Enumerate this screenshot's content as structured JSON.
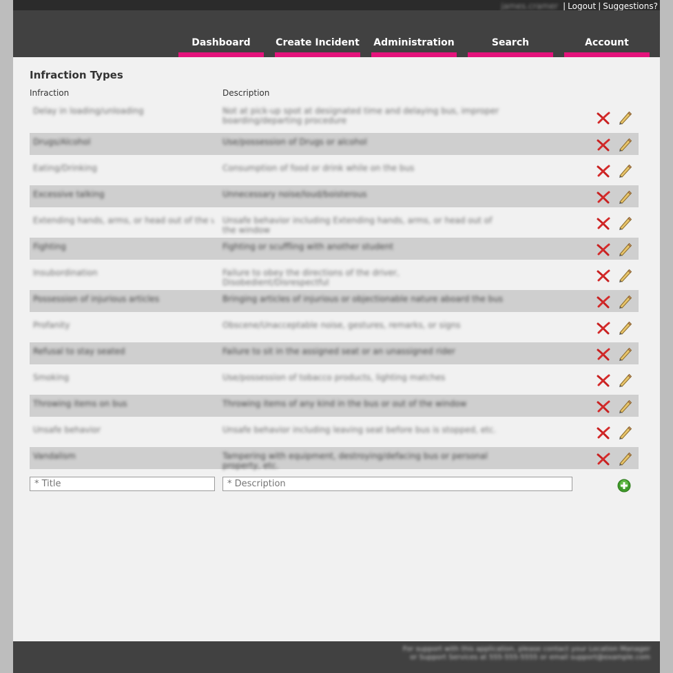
{
  "topbar": {
    "username": "james.cramer",
    "logout_label": "Logout",
    "suggestions_label": "Suggestions?",
    "separator": "|"
  },
  "nav": {
    "items": [
      {
        "label": "Dashboard"
      },
      {
        "label": "Create Incident"
      },
      {
        "label": "Administration"
      },
      {
        "label": "Search"
      },
      {
        "label": "Account"
      }
    ],
    "accent_color": "#e4137b"
  },
  "main": {
    "title": "Infraction Types",
    "columns": [
      "Infraction",
      "Description"
    ],
    "rows": [
      {
        "title": "Delay in loading/unloading",
        "description": "Not at pick-up spot at designated time and delaying bus, improper boarding/departing procedure"
      },
      {
        "title": "Drugs/Alcohol",
        "description": "Use/possession of Drugs or alcohol"
      },
      {
        "title": "Eating/Drinking",
        "description": "Consumption of food or drink while on the bus"
      },
      {
        "title": "Excessive talking",
        "description": "Unnecessary noise/loud/boisterous"
      },
      {
        "title": "Extending hands, arms, or head out of the window",
        "description": "Unsafe behavior including Extending hands, arms, or head out of the window"
      },
      {
        "title": "Fighting",
        "description": "Fighting or scuffling with another student"
      },
      {
        "title": "Insubordination",
        "description": "Failure to obey the directions of the driver, Disobedient/Disrespectful"
      },
      {
        "title": "Possession of injurious articles",
        "description": "Bringing articles of injurious or objectionable nature aboard the bus"
      },
      {
        "title": "Profanity",
        "description": "Obscene/Unacceptable noise, gestures, remarks, or signs"
      },
      {
        "title": "Refusal to stay seated",
        "description": "Failure to sit in the assigned seat or an unassigned rider"
      },
      {
        "title": "Smoking",
        "description": "Use/possession of tobacco products, lighting matches"
      },
      {
        "title": "Throwing items on bus",
        "description": "Throwing items of any kind in the bus or out of the window"
      },
      {
        "title": "Unsafe behavior",
        "description": "Unsafe behavior including leaving seat before bus is stopped, etc."
      },
      {
        "title": "Vandalism",
        "description": "Tampering with equipment, destroying/defacing bus or personal property, etc."
      }
    ],
    "row_icons": {
      "delete": "delete-x-icon",
      "edit": "pencil-icon"
    },
    "new_title_placeholder": "* Title",
    "new_description_placeholder": "* Description",
    "add_icon": "add-plus-icon"
  },
  "footer": {
    "text": "For support with this application, please contact your Location Manager or Support Services at 555-555-5555 or email support@example.com"
  }
}
